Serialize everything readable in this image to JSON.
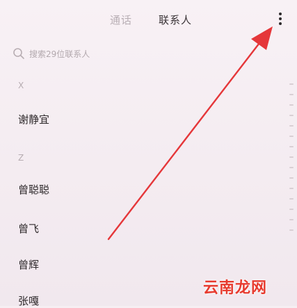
{
  "header": {
    "tabs": [
      {
        "label": "通话",
        "active": false
      },
      {
        "label": "联系人",
        "active": true
      }
    ]
  },
  "search": {
    "placeholder": "搜索29位联系人"
  },
  "contacts": {
    "sections": [
      {
        "letter": "X",
        "names": [
          "谢静宜"
        ]
      },
      {
        "letter": "Z",
        "names": [
          "曾聪聪",
          "曾飞",
          "曾辉",
          "张嘎"
        ]
      }
    ]
  },
  "watermark": {
    "text": "云南龙网"
  },
  "colors": {
    "arrow": "#e5373a",
    "watermark": "#e73b2f",
    "background": "#f6eef2"
  },
  "icons": {
    "menu": "more-vertical-icon",
    "search": "search-icon"
  }
}
